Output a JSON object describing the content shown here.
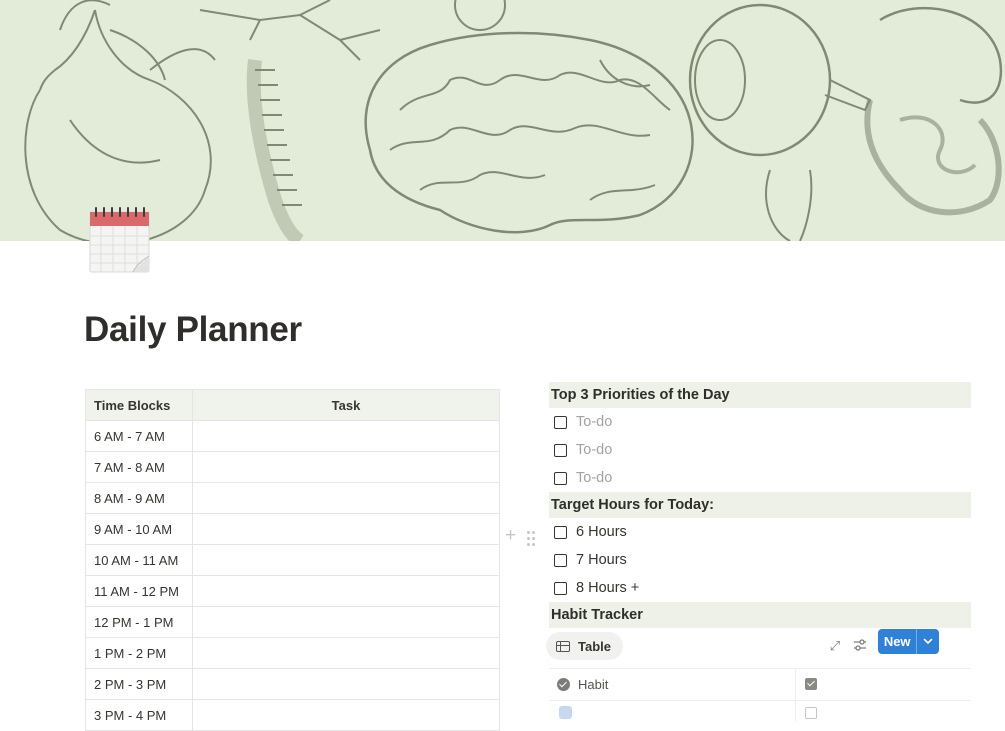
{
  "page": {
    "icon": "spiral-calendar-icon",
    "title": "Daily Planner",
    "cover": "vintage-anatomy-illustration"
  },
  "time_table": {
    "headers": [
      "Time Blocks",
      "Task"
    ],
    "rows": [
      "6 AM - 7 AM",
      "7 AM - 8 AM",
      "8 AM - 9 AM",
      "9 AM - 10 AM",
      "10 AM - 11 AM",
      "11 AM - 12 PM",
      "12 PM - 1 PM",
      "1 PM - 2 PM",
      "2 PM - 3 PM",
      "3 PM - 4 PM"
    ]
  },
  "priorities": {
    "heading": "Top 3 Priorities of the Day",
    "items": [
      {
        "label": "To-do",
        "checked": false,
        "placeholder": true
      },
      {
        "label": "To-do",
        "checked": false,
        "placeholder": true
      },
      {
        "label": "To-do",
        "checked": false,
        "placeholder": true
      }
    ]
  },
  "target_hours": {
    "heading": "Target Hours for Today:",
    "items": [
      {
        "label": "6 Hours",
        "checked": false
      },
      {
        "label": "7 Hours",
        "checked": false
      },
      {
        "label": "8 Hours +",
        "checked": false
      }
    ]
  },
  "habit_tracker": {
    "heading": "Habit Tracker",
    "view_tab": "Table",
    "new_button": "New",
    "column_header": "Habit"
  },
  "colors": {
    "accent": "#2f80d7",
    "heading_bg": "#edf1e8",
    "cover_bg": "#e3ecd9"
  }
}
